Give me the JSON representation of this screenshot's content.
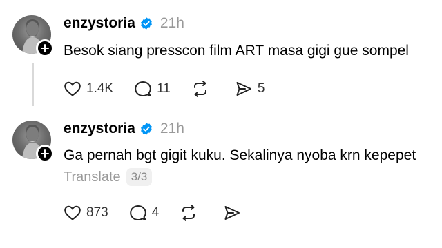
{
  "posts": [
    {
      "username": "enzystoria",
      "time": "21h",
      "text": "Besok siang presscon film ART masa gigi gue sompel",
      "likes": "1.4K",
      "replies": "11",
      "reposts": "",
      "shares": "5"
    },
    {
      "username": "enzystoria",
      "time": "21h",
      "text": "Ga pernah bgt gigit kuku. Sekalinya nyoba krn kepepet",
      "translate_label": "Translate",
      "page_badge": "3/3",
      "likes": "873",
      "replies": "4",
      "reposts": "",
      "shares": ""
    }
  ],
  "icons": [
    "heart-icon",
    "comment-icon",
    "repost-icon",
    "share-icon",
    "verified-badge-icon",
    "plus-icon"
  ],
  "colors": {
    "text": "#000000",
    "muted": "#999999",
    "verified": "#0095f6",
    "thread_line": "#d9d9d9"
  }
}
